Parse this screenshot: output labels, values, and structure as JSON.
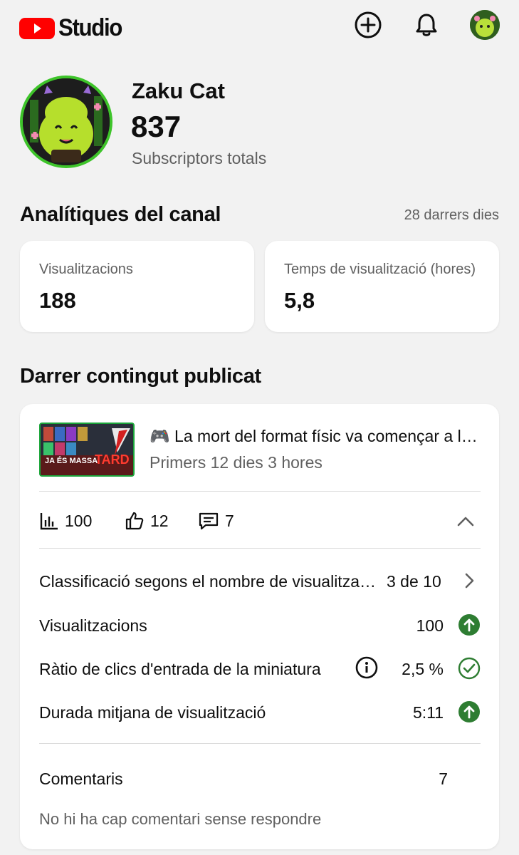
{
  "header": {
    "brand_text": "Studio",
    "brand_color": "#ff0000",
    "icons": [
      "create-icon",
      "notifications-icon",
      "account-avatar"
    ]
  },
  "channel": {
    "name": "Zaku Cat",
    "subscribers": "837",
    "subscribers_label": "Subscriptors totals"
  },
  "analytics": {
    "title": "Analítiques del canal",
    "range": "28 darrers dies",
    "metrics": [
      {
        "label": "Visualitzacions",
        "value": "188"
      },
      {
        "label": "Temps de visualització (hores)",
        "value": "5,8"
      }
    ]
  },
  "latest": {
    "title": "Darrer contingut publicat",
    "video": {
      "title": "🎮 La mort del format físic va començar a la indústria dels videojocs",
      "timeframe": "Primers 12 dies 3 hores",
      "thumbnail_text_1": "JA ÉS MASSA",
      "thumbnail_text_2": "TARD"
    },
    "stats": {
      "views": "100",
      "likes": "12",
      "comments": "7"
    },
    "rows": [
      {
        "label": "Classificació segons el nombre de visualitzacions",
        "value": "3 de 10",
        "status": "chevron-right-icon"
      },
      {
        "label": "Visualitzacions",
        "value": "100",
        "status": "arrow-up-icon"
      },
      {
        "label": "Ràtio de clics d'entrada de la miniatura",
        "value": "2,5 %",
        "status": "check-circle-icon"
      },
      {
        "label": "Durada mitjana de visualització",
        "value": "5:11",
        "status": "arrow-up-icon"
      }
    ],
    "comments": {
      "label": "Comentaris",
      "count": "7",
      "note": "No hi ha cap comentari sense respondre"
    },
    "status_color": "#2e7d32"
  }
}
